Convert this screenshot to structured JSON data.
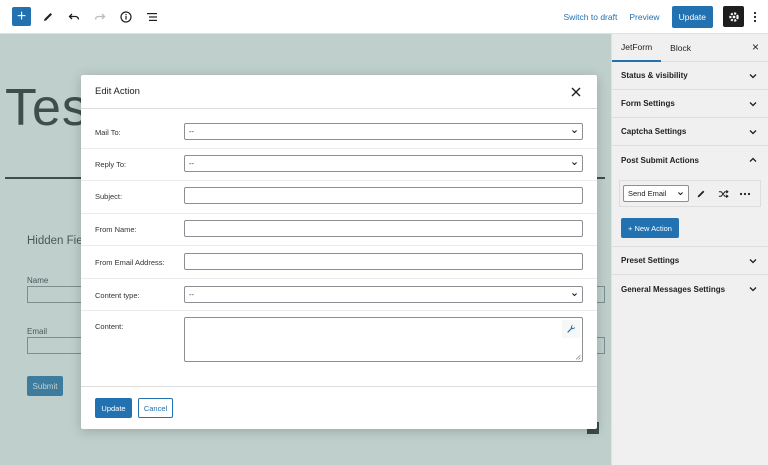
{
  "toolbar": {
    "add_symbol": "+",
    "switch_to_draft": "Switch to draft",
    "preview": "Preview",
    "update": "Update",
    "icons": [
      "pencil-icon",
      "undo-icon",
      "redo-icon",
      "info-icon",
      "list-view-icon",
      "gear-icon",
      "kebab-menu-icon"
    ]
  },
  "editor": {
    "title": "Test",
    "hidden_fields_heading": "Hidden Fie",
    "name_label": "Name",
    "email_label": "Email",
    "submit_label": "Submit"
  },
  "sidebar": {
    "tabs": [
      {
        "label": "JetForm"
      },
      {
        "label": "Block"
      }
    ],
    "close_symbol": "×",
    "panels": {
      "status_visibility": "Status & visibility",
      "form_settings": "Form Settings",
      "captcha_settings": "Captcha Settings",
      "post_submit_actions": "Post Submit Actions",
      "preset_settings": "Preset Settings",
      "general_messages": "General Messages Settings"
    },
    "action": {
      "selected": "Send Email",
      "new_action": "+ New Action"
    }
  },
  "modal": {
    "title": "Edit Action",
    "fields": {
      "mail_to": {
        "label": "Mail To:",
        "value": "--"
      },
      "reply_to": {
        "label": "Reply To:",
        "value": "--"
      },
      "subject": {
        "label": "Subject:",
        "value": ""
      },
      "from_name": {
        "label": "From Name:",
        "value": ""
      },
      "from_email": {
        "label": "From Email Address:",
        "value": ""
      },
      "content_type": {
        "label": "Content type:",
        "value": "--"
      },
      "content": {
        "label": "Content:",
        "value": ""
      }
    },
    "update": "Update",
    "cancel": "Cancel"
  },
  "colors": {
    "accent": "#2271b1",
    "dark": "#1e1e1e",
    "overlay": "#678c86"
  }
}
